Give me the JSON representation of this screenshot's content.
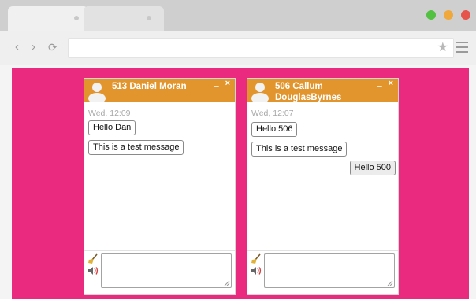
{
  "colors": {
    "page_bg": "#ea2a7f",
    "chat_header": "#e3952d"
  },
  "browser": {
    "icons": [
      "back-icon",
      "forward-icon",
      "reload-icon",
      "bookmark-star-icon",
      "menu-icon"
    ],
    "back_glyph": "‹",
    "forward_glyph": "›",
    "reload_glyph": "⟳",
    "star_glyph": "★",
    "window_controls": [
      "#52c041",
      "#f0a83a",
      "#e5534b"
    ]
  },
  "chats": [
    {
      "title": "513 Daniel Moran",
      "minimize": "–",
      "close": "×",
      "timestamp": "Wed, 12:09",
      "messages": [
        {
          "text": "Hello Dan",
          "dir": "in"
        },
        {
          "text": "This is a test message",
          "dir": "in"
        }
      ]
    },
    {
      "title": "506 Callum DouglasByrnes",
      "minimize": "–",
      "close": "×",
      "timestamp": "Wed, 12:07",
      "messages": [
        {
          "text": "Hello 506",
          "dir": "in"
        },
        {
          "text": "This is a test message",
          "dir": "in"
        },
        {
          "text": "Hello 500",
          "dir": "out"
        }
      ]
    }
  ]
}
